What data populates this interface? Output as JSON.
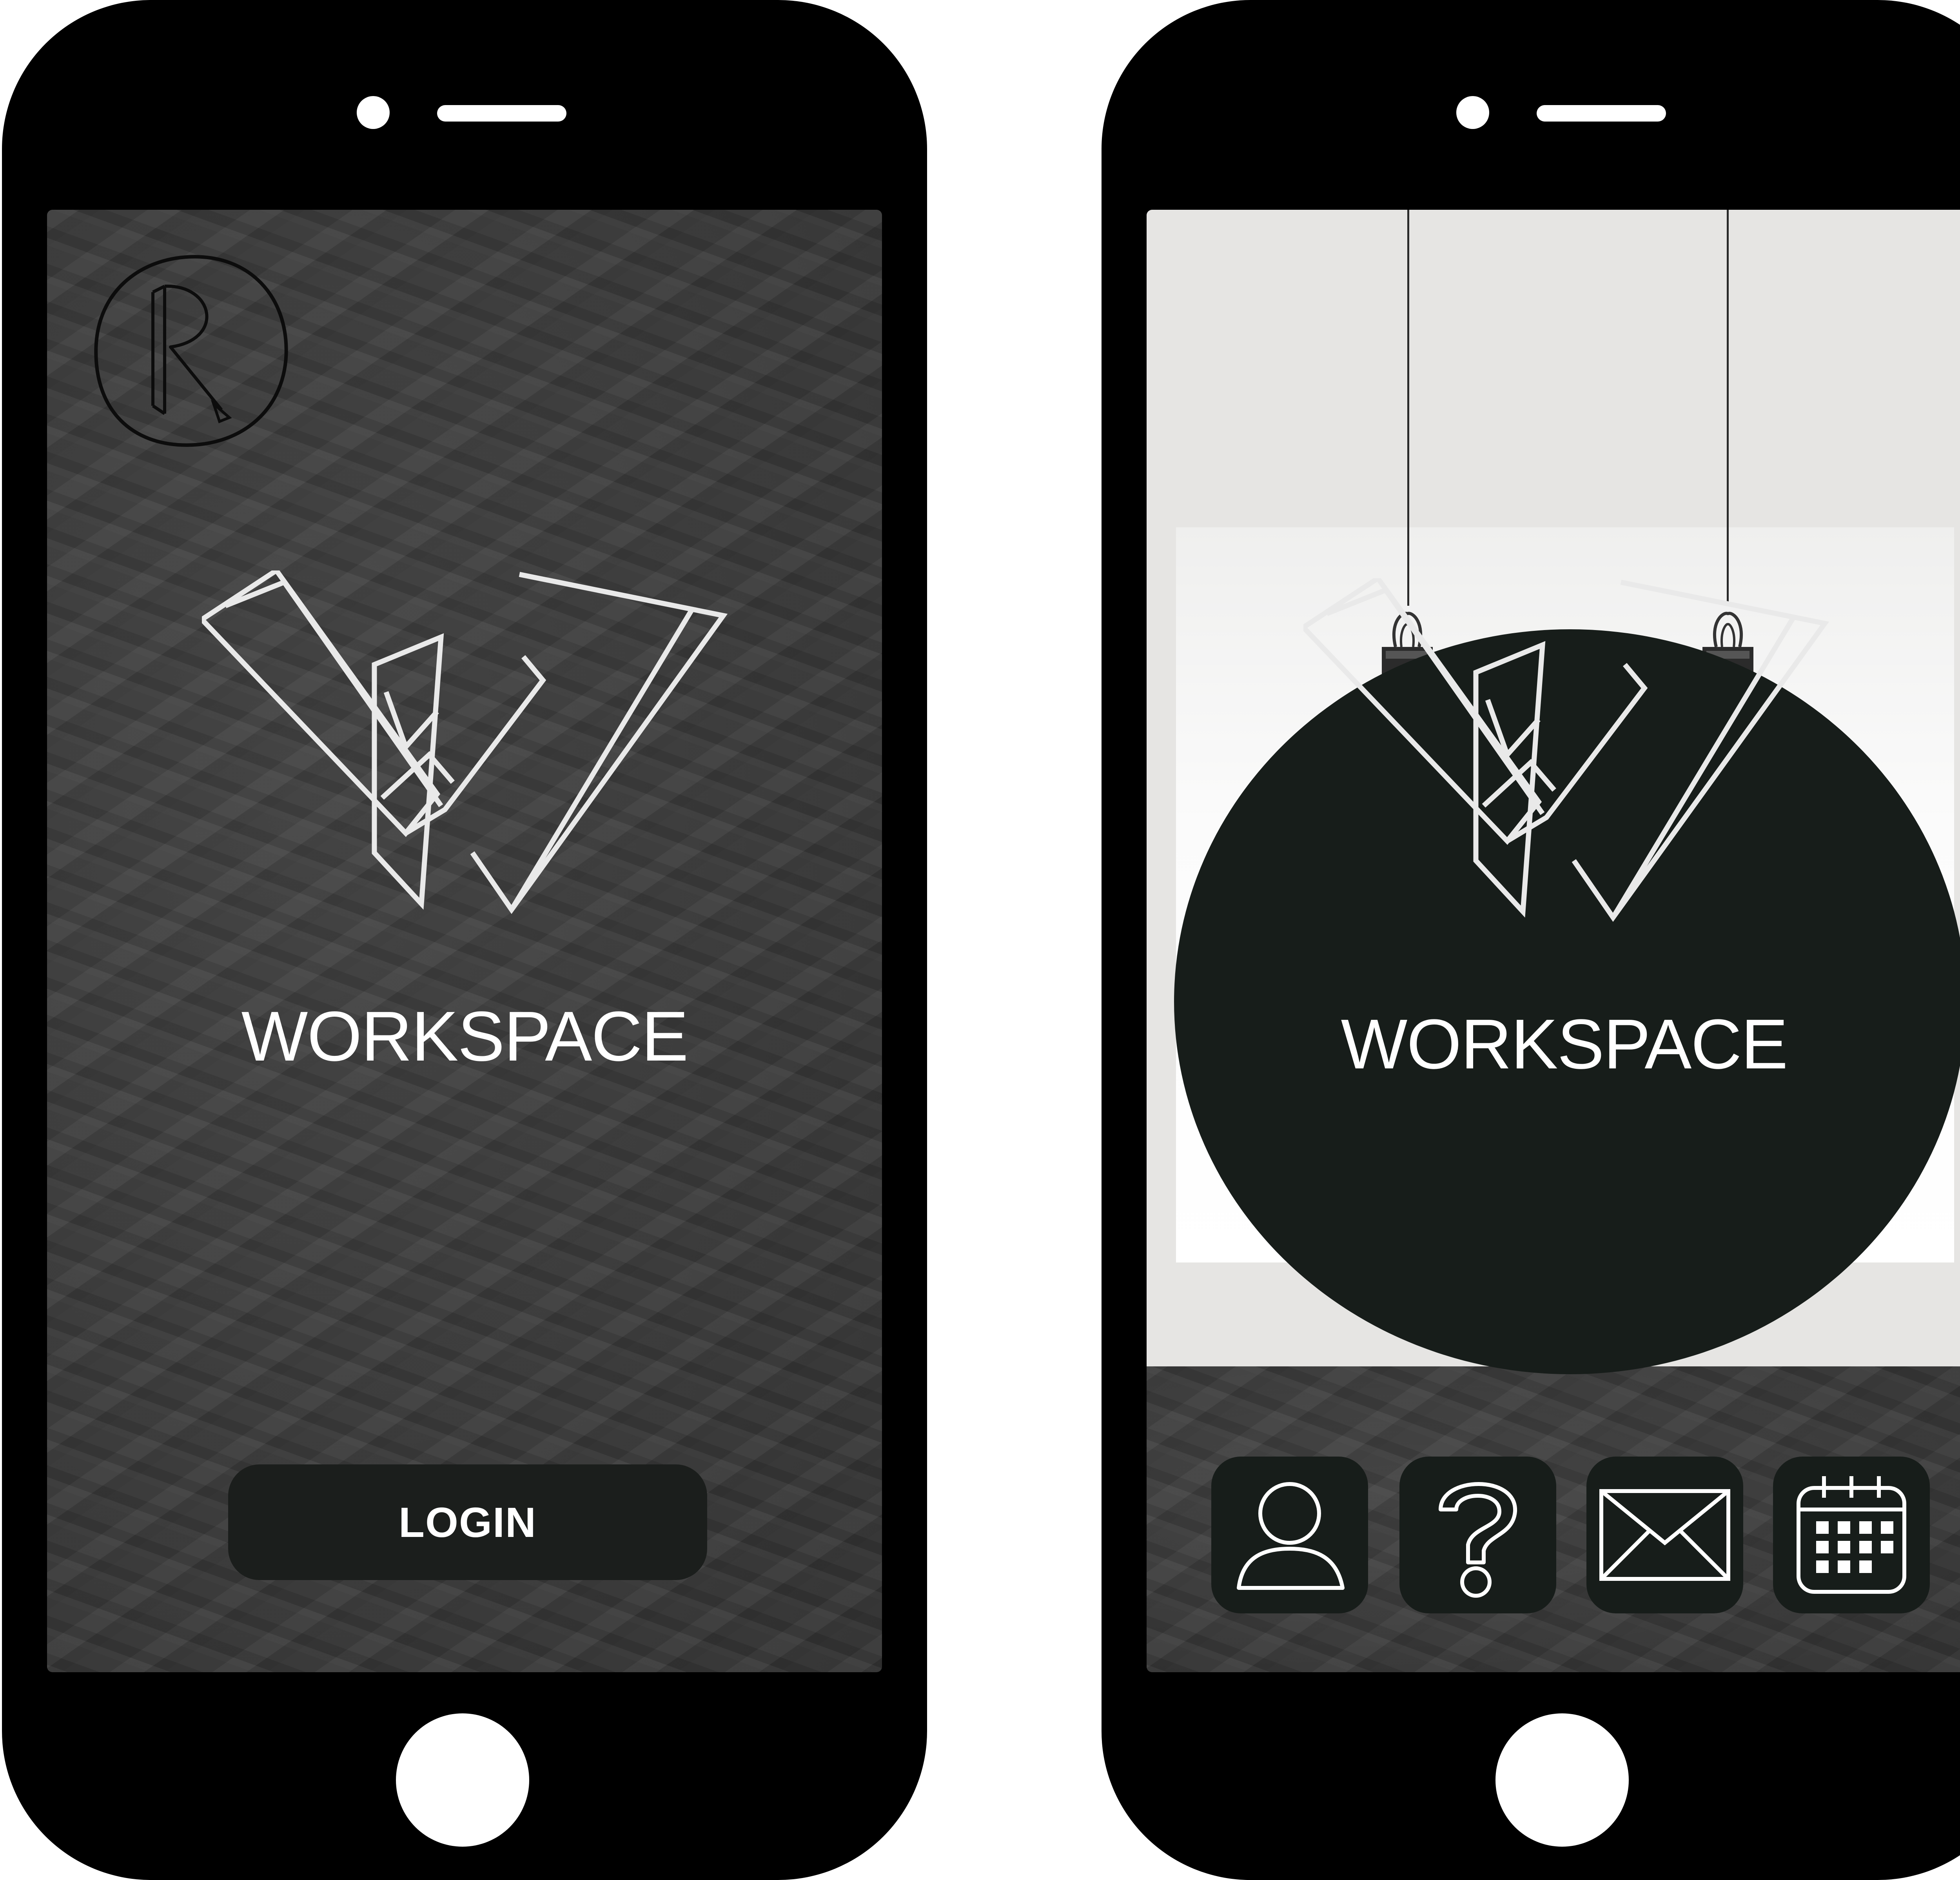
{
  "login_screen": {
    "brand_badge_letter": "R",
    "wordmark": "WORKSPACE",
    "login_label": "LOGIN"
  },
  "home_screen": {
    "wordmark": "WORKSPACE",
    "tiles": [
      {
        "icon": "user-icon"
      },
      {
        "icon": "help-icon"
      },
      {
        "icon": "mail-icon"
      },
      {
        "icon": "calendar-icon"
      }
    ]
  },
  "colors": {
    "device": "#000000",
    "dark_panel": "#1b1e1c",
    "sign": "#171d1a",
    "wood": "#3b3b3b",
    "text": "#ffffff"
  }
}
